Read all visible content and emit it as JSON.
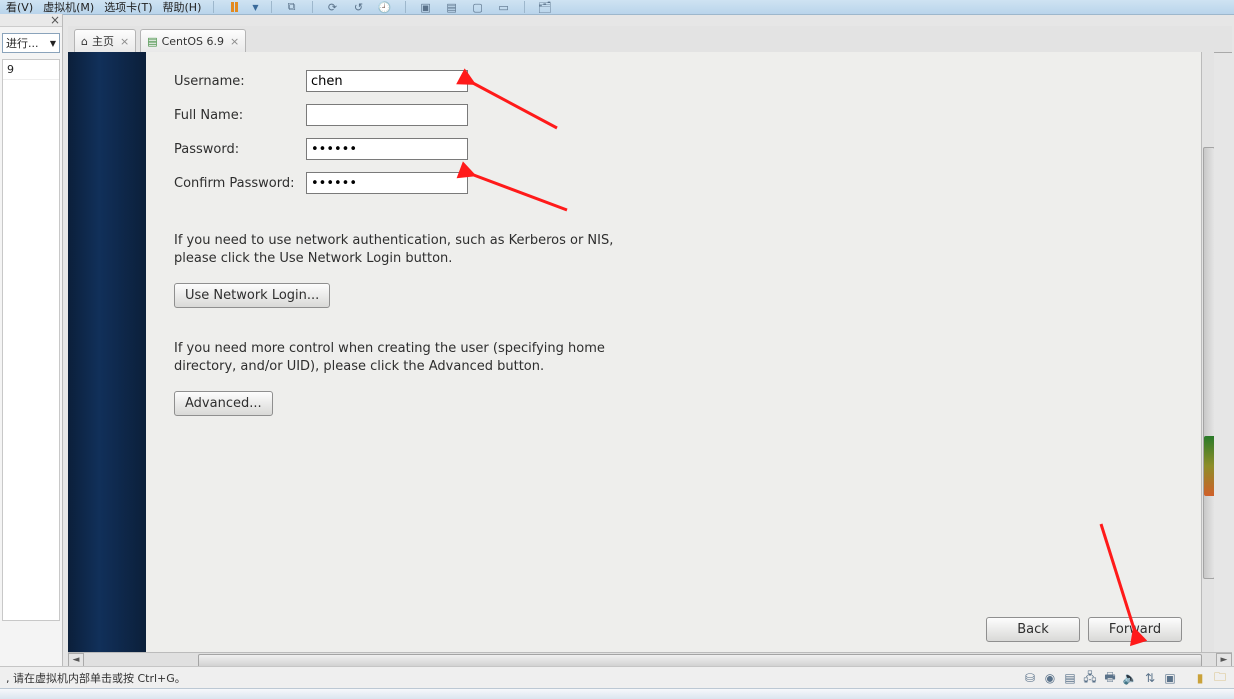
{
  "host": {
    "menu": {
      "view": "看(V)",
      "vm": "虚拟机(M)",
      "tabs": "选项卡(T)",
      "help": "帮助(H)"
    },
    "sidebar": {
      "combo": "进行...",
      "list_item": "9",
      "close": "×"
    },
    "tabs": [
      {
        "icon": "home",
        "label": "主页",
        "close": "×"
      },
      {
        "icon": "vm",
        "label": "CentOS 6.9",
        "close": "×"
      }
    ],
    "status": ", 请在虚拟机内部单击或按 Ctrl+G。"
  },
  "centos": {
    "form": {
      "username_label": "Username:",
      "username_value": "chen",
      "fullname_label": "Full Name:",
      "fullname_value": "",
      "password_label": "Password:",
      "password_value": "••••••",
      "confirm_label": "Confirm Password:",
      "confirm_value": "••••••"
    },
    "texts": {
      "network_info": "If you need to use network authentication, such as Kerberos or NIS, please click the Use Network Login button.",
      "advanced_info": "If you need more control when creating the user (specifying home directory, and/or UID), please click the Advanced button."
    },
    "buttons": {
      "network": "Use Network Login...",
      "advanced": "Advanced...",
      "back": "Back",
      "forward": "Forward"
    }
  }
}
